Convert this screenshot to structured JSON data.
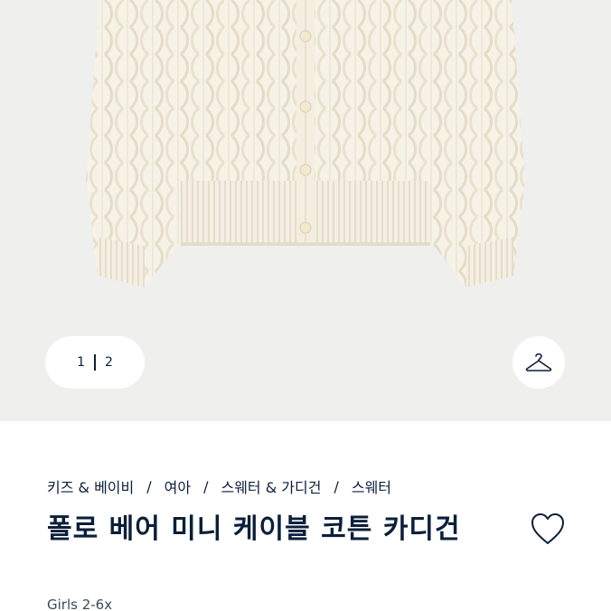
{
  "gallery": {
    "image_alt": "cream cable knit cardigan",
    "pager": {
      "current": "1",
      "total": "2"
    },
    "hanger_icon": "hanger-icon"
  },
  "breadcrumb": [
    "키즈 & 베이비",
    "여아",
    "스웨터 & 가디건",
    "스웨터"
  ],
  "breadcrumb_separator": "/",
  "product": {
    "title": "폴로 베어 미니 케이블 코튼 카디건",
    "subtitle": "Girls 2-6x",
    "wishlist_icon": "heart-icon"
  },
  "colors": {
    "brand_navy": "#0b1f3a",
    "sweater": "#f6f2e6",
    "background": "#efefee"
  }
}
